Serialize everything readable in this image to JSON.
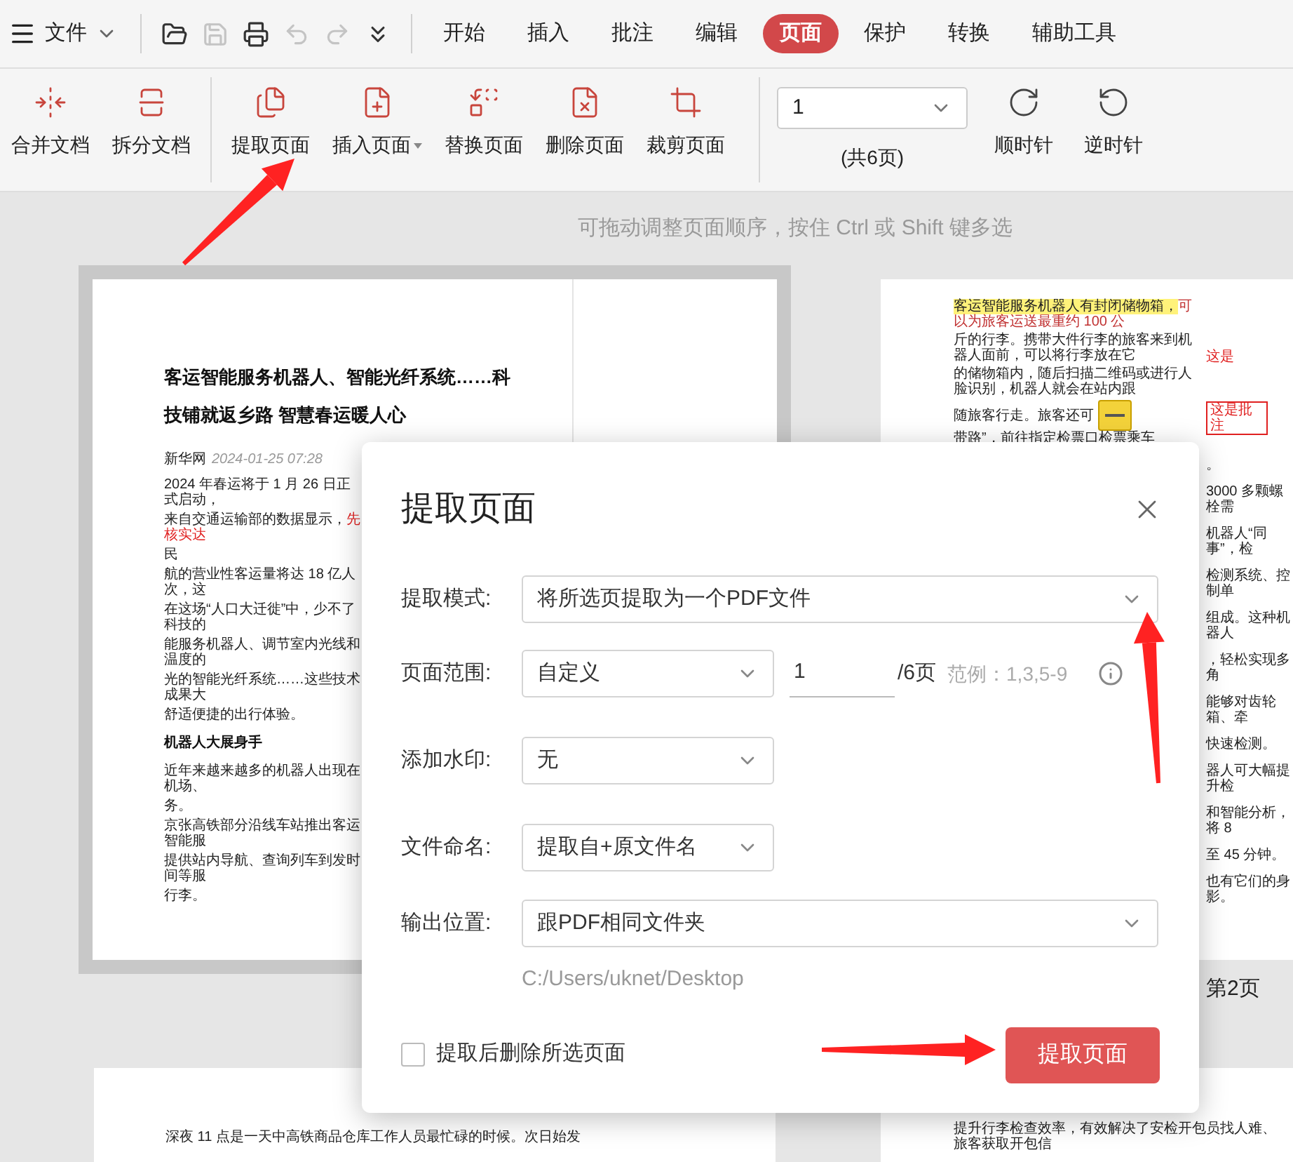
{
  "menu": {
    "label": "文件"
  },
  "quick_tools": [
    {
      "disabled": false
    },
    {
      "disabled": true
    },
    {
      "disabled": false
    },
    {
      "disabled": true
    },
    {
      "disabled": true
    },
    {
      "disabled": false
    }
  ],
  "tabs": [
    {
      "label": "开始",
      "selected": false
    },
    {
      "label": "插入",
      "selected": false
    },
    {
      "label": "批注",
      "selected": false
    },
    {
      "label": "编辑",
      "selected": false
    },
    {
      "label": "页面",
      "selected": true
    },
    {
      "label": "保护",
      "selected": false
    },
    {
      "label": "转换",
      "selected": false
    },
    {
      "label": "辅助工具",
      "selected": false
    }
  ],
  "ribbon": {
    "groups": [
      [
        {
          "label": "合并文档",
          "dropdown": false
        },
        {
          "label": "拆分文档",
          "dropdown": false
        }
      ],
      [
        {
          "label": "提取页面",
          "dropdown": false
        },
        {
          "label": "插入页面",
          "dropdown": true
        },
        {
          "label": "替换页面",
          "dropdown": false
        },
        {
          "label": "删除页面",
          "dropdown": false
        },
        {
          "label": "裁剪页面",
          "dropdown": false
        }
      ]
    ],
    "page_select": "1",
    "page_count": "(共6页)",
    "rotate": [
      {
        "label": "顺时针"
      },
      {
        "label": "逆时针"
      }
    ]
  },
  "hint": "可拖动调整页面顺序，按住 Ctrl 或 Shift 键多选",
  "page1": {
    "selected": true,
    "title_lines": [
      "客运智能服务机器人、智能光纤系统……科",
      "技铺就返乡路 智慧春运暖人心"
    ],
    "source": "新华网",
    "date": "2024-01-25 07:28",
    "lines": [
      {
        "kind": "body",
        "text": "2024 年春运将于 1 月 26 日正式启动，"
      },
      {
        "kind": "body",
        "text": "来自交通运输部的数据显示，",
        "red_text": "先核实达"
      },
      {
        "kind": "body",
        "text": "民"
      },
      {
        "kind": "body",
        "text": "航的营业性客运量将达 18 亿人次，这"
      },
      {
        "kind": "body",
        "text": "在这场“人口大迁徙”中，少不了科技的"
      },
      {
        "kind": "body",
        "text": "能服务机器人、调节室内光线和温度的"
      },
      {
        "kind": "body",
        "text": "光的智能光纤系统……这些技术成果大"
      },
      {
        "kind": "body",
        "text": "舒适便捷的出行体验。"
      },
      {
        "kind": "heading",
        "text": "机器人大展身手"
      },
      {
        "kind": "body",
        "text": "近年来越来越多的机器人出现在机场、"
      },
      {
        "kind": "body",
        "text": "务。"
      },
      {
        "kind": "body",
        "text": "京张高铁部分沿线车站推出客运智能服"
      },
      {
        "kind": "body",
        "text": "提供站内导航、查询列车到发时间等服"
      },
      {
        "kind": "body",
        "text": "行李。"
      }
    ]
  },
  "page2": {
    "selected": false,
    "highlight": "客运智能服务机器人有封闭储物箱，",
    "struck": "可以为旅客运送最重约 100 公",
    "lines": [
      "斤的行李。携带大件行李的旅客来到机器人面前，可以将行李放在它",
      "的储物箱内，随后扫描二维码或进行人脸识别，机器人就会在站内跟"
    ],
    "before_note": "随旅客行走。旅客还可",
    "after_note": "带路”，前往指定检票口检票乘车",
    "comments": [
      "这是",
      "这是批注"
    ],
    "fragments": [
      "。",
      "3000 多颗螺栓需",
      "机器人“同事”，检",
      "检测系统、控制单",
      "组成。这种机器人",
      "，轻松实现多角",
      "能够对齿轮箱、牵",
      "快速检测。",
      "器人可大幅提升检",
      "和智能分析，将 8",
      "至 45 分钟。",
      "也有它们的身影。"
    ],
    "label": "第2页"
  },
  "page3": {
    "text": "深夜 11 点是一天中高铁商品仓库工作人员最忙碌的时候。次日始发"
  },
  "page4": {
    "text": "提升行李检查效率，有效解决了安检开包员找人难、旅客获取开包信"
  },
  "dialog": {
    "title": "提取页面",
    "mode": {
      "label": "提取模式:",
      "value": "将所选页提取为一个PDF文件"
    },
    "range": {
      "label": "页面范围:",
      "value": "自定义",
      "input": "1",
      "total": "/6页",
      "example": "范例：1,3,5-9"
    },
    "watermark": {
      "label": "添加水印:",
      "value": "无"
    },
    "naming": {
      "label": "文件命名:",
      "value": "提取自+原文件名"
    },
    "output": {
      "label": "输出位置:",
      "value": "跟PDF相同文件夹",
      "path": "C:/Users/uknet/Desktop"
    },
    "delete_after": {
      "label": "提取后删除所选页面",
      "checked": false
    },
    "submit": "提取页面"
  }
}
